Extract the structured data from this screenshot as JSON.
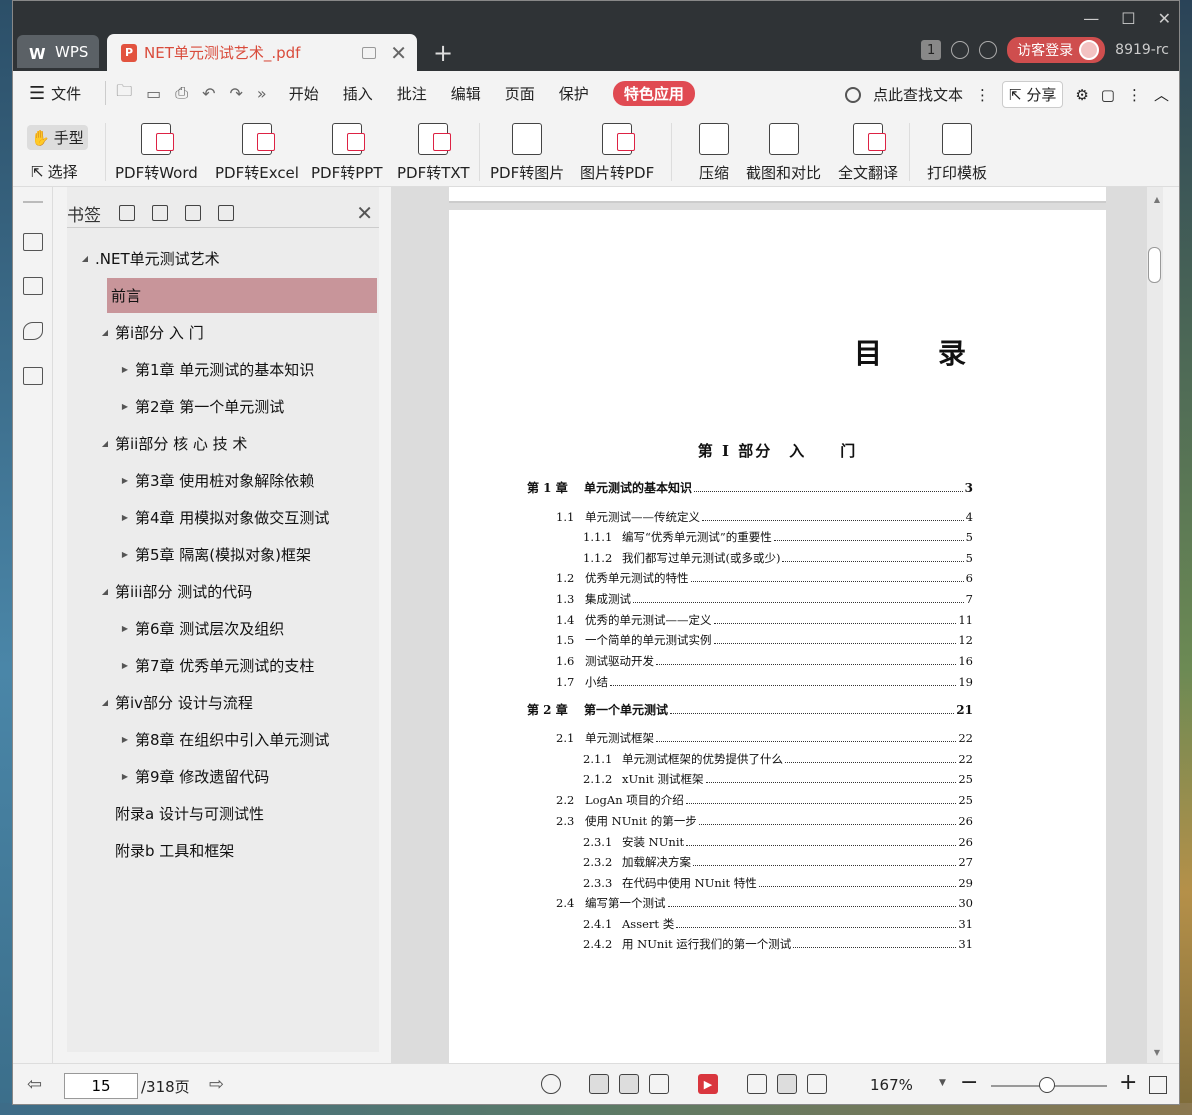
{
  "titlebar": {
    "wps_label": "WPS",
    "doc_tab_title": "NET单元测试艺术_.pdf",
    "badge": "1",
    "login_label": "访客登录",
    "user_id": "8919-rc"
  },
  "menubar": {
    "file_label": "文件",
    "items": [
      "开始",
      "插入",
      "批注",
      "编辑",
      "页面",
      "保护"
    ],
    "special": "特色应用",
    "search_label": "点此查找文本",
    "share_label": "分享"
  },
  "ribbon": {
    "hand_label": "手型",
    "select_label": "选择",
    "tools": [
      "PDF转Word",
      "PDF转Excel",
      "PDF转PPT",
      "PDF转TXT",
      "PDF转图片",
      "图片转PDF",
      "压缩",
      "截图和对比",
      "全文翻译",
      "打印模板"
    ]
  },
  "bookmarks": {
    "title": "书签",
    "items": [
      {
        "label": ".NET单元测试艺术",
        "level": 0,
        "arrow": "down"
      },
      {
        "label": "前言",
        "level": 1,
        "arrow": "none",
        "selected": true
      },
      {
        "label": "第i部分 入 门",
        "level": 1,
        "arrow": "down"
      },
      {
        "label": "第1章 单元测试的基本知识",
        "level": 2,
        "arrow": "right"
      },
      {
        "label": "第2章 第一个单元测试",
        "level": 2,
        "arrow": "right"
      },
      {
        "label": "第ii部分 核 心 技 术",
        "level": 1,
        "arrow": "down"
      },
      {
        "label": "第3章 使用桩对象解除依赖",
        "level": 2,
        "arrow": "right"
      },
      {
        "label": "第4章 用模拟对象做交互测试",
        "level": 2,
        "arrow": "right"
      },
      {
        "label": "第5章 隔离(模拟对象)框架",
        "level": 2,
        "arrow": "right"
      },
      {
        "label": "第iii部分 测试的代码",
        "level": 1,
        "arrow": "down"
      },
      {
        "label": "第6章 测试层次及组织",
        "level": 2,
        "arrow": "right"
      },
      {
        "label": "第7章 优秀单元测试的支柱",
        "level": 2,
        "arrow": "right"
      },
      {
        "label": "第iv部分 设计与流程",
        "level": 1,
        "arrow": "down"
      },
      {
        "label": "第8章 在组织中引入单元测试",
        "level": 2,
        "arrow": "right"
      },
      {
        "label": "第9章 修改遗留代码",
        "level": 2,
        "arrow": "right"
      },
      {
        "label": "附录a 设计与可测试性",
        "level": 1,
        "arrow": "none"
      },
      {
        "label": "附录b 工具和框架",
        "level": 1,
        "arrow": "none"
      }
    ]
  },
  "page": {
    "toc_title": "目录",
    "part_title": "第 I 部分　入　　门",
    "entries": [
      {
        "num": "第 1 章",
        "title": "单元测试的基本知识",
        "page": "3",
        "kind": "chap"
      },
      {
        "num": "1.1",
        "title": "单元测试——传统定义",
        "page": "4",
        "kind": "sec"
      },
      {
        "num": "1.1.1",
        "title": "编写“优秀单元测试”的重要性",
        "page": "5",
        "kind": "sub"
      },
      {
        "num": "1.1.2",
        "title": "我们都写过单元测试(或多或少)",
        "page": "5",
        "kind": "sub"
      },
      {
        "num": "1.2",
        "title": "优秀单元测试的特性",
        "page": "6",
        "kind": "sec"
      },
      {
        "num": "1.3",
        "title": "集成测试",
        "page": "7",
        "kind": "sec"
      },
      {
        "num": "1.4",
        "title": "优秀的单元测试——定义",
        "page": "11",
        "kind": "sec"
      },
      {
        "num": "1.5",
        "title": "一个简单的单元测试实例",
        "page": "12",
        "kind": "sec"
      },
      {
        "num": "1.6",
        "title": "测试驱动开发",
        "page": "16",
        "kind": "sec"
      },
      {
        "num": "1.7",
        "title": "小结",
        "page": "19",
        "kind": "sec"
      },
      {
        "num": "第 2 章",
        "title": "第一个单元测试",
        "page": "21",
        "kind": "chap"
      },
      {
        "num": "2.1",
        "title": "单元测试框架",
        "page": "22",
        "kind": "sec"
      },
      {
        "num": "2.1.1",
        "title": "单元测试框架的优势提供了什么",
        "page": "22",
        "kind": "sub"
      },
      {
        "num": "2.1.2",
        "title": "xUnit 测试框架",
        "page": "25",
        "kind": "sub"
      },
      {
        "num": "2.2",
        "title": "LogAn 项目的介绍",
        "page": "25",
        "kind": "sec"
      },
      {
        "num": "2.3",
        "title": "使用 NUnit 的第一步",
        "page": "26",
        "kind": "sec"
      },
      {
        "num": "2.3.1",
        "title": "安装 NUnit",
        "page": "26",
        "kind": "sub"
      },
      {
        "num": "2.3.2",
        "title": "加载解决方案",
        "page": "27",
        "kind": "sub"
      },
      {
        "num": "2.3.3",
        "title": "在代码中使用 NUnit 特性",
        "page": "29",
        "kind": "sub"
      },
      {
        "num": "2.4",
        "title": "编写第一个测试",
        "page": "30",
        "kind": "sec"
      },
      {
        "num": "2.4.1",
        "title": "Assert 类",
        "page": "31",
        "kind": "sub"
      },
      {
        "num": "2.4.2",
        "title": "用 NUnit 运行我们的第一个测试",
        "page": "31",
        "kind": "sub"
      }
    ]
  },
  "statusbar": {
    "current_page": "15",
    "total_pages": "/318页",
    "zoom": "167%"
  }
}
